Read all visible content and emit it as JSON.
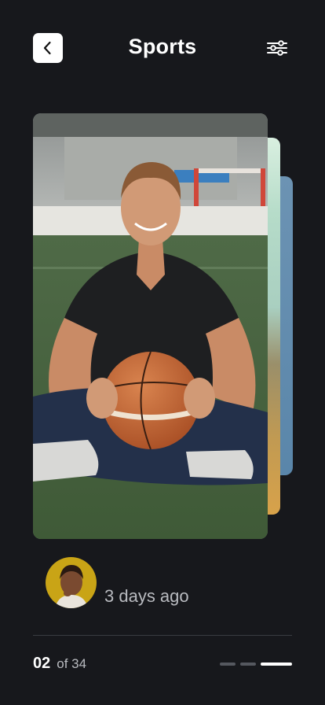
{
  "header": {
    "title": "Sports",
    "back_icon": "chevron-left-icon",
    "filter_icon": "sliders-icon"
  },
  "post": {
    "time_ago": "3 days ago"
  },
  "pagination": {
    "current": "02",
    "total": "of 34",
    "active_index": 3,
    "dot_count": 3
  },
  "colors": {
    "background": "#17181c",
    "text_primary": "#ffffff",
    "text_secondary": "#b9bbc0",
    "divider": "#3a3c42",
    "dot_inactive": "#55585f",
    "dot_active": "#ffffff"
  }
}
